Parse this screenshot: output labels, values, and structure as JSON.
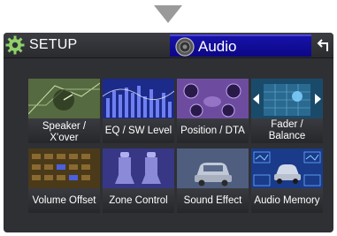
{
  "header": {
    "setup_label": "SETUP",
    "audio_label": "Audio"
  },
  "icons": {
    "down_arrow": "down-triangle-icon",
    "setup": "gear-icon",
    "audio": "speaker-icon",
    "back": "return-arrow-icon"
  },
  "tiles": [
    {
      "label": "Speaker / X'over",
      "icon": "speaker-crossover-icon"
    },
    {
      "label": "EQ / SW Level",
      "icon": "equalizer-icon"
    },
    {
      "label": "Position / DTA",
      "icon": "speakers-position-icon"
    },
    {
      "label": "Fader / Balance",
      "icon": "fader-balance-icon"
    },
    {
      "label": "Volume Offset",
      "icon": "volume-grid-icon"
    },
    {
      "label": "Zone Control",
      "icon": "car-seats-icon"
    },
    {
      "label": "Sound Effect",
      "icon": "car-sound-icon"
    },
    {
      "label": "Audio Memory",
      "icon": "car-waveform-icon"
    }
  ],
  "colors": {
    "screen_bg": "#2f3034",
    "active_tab": "#1410a0",
    "text": "#ffffff"
  }
}
